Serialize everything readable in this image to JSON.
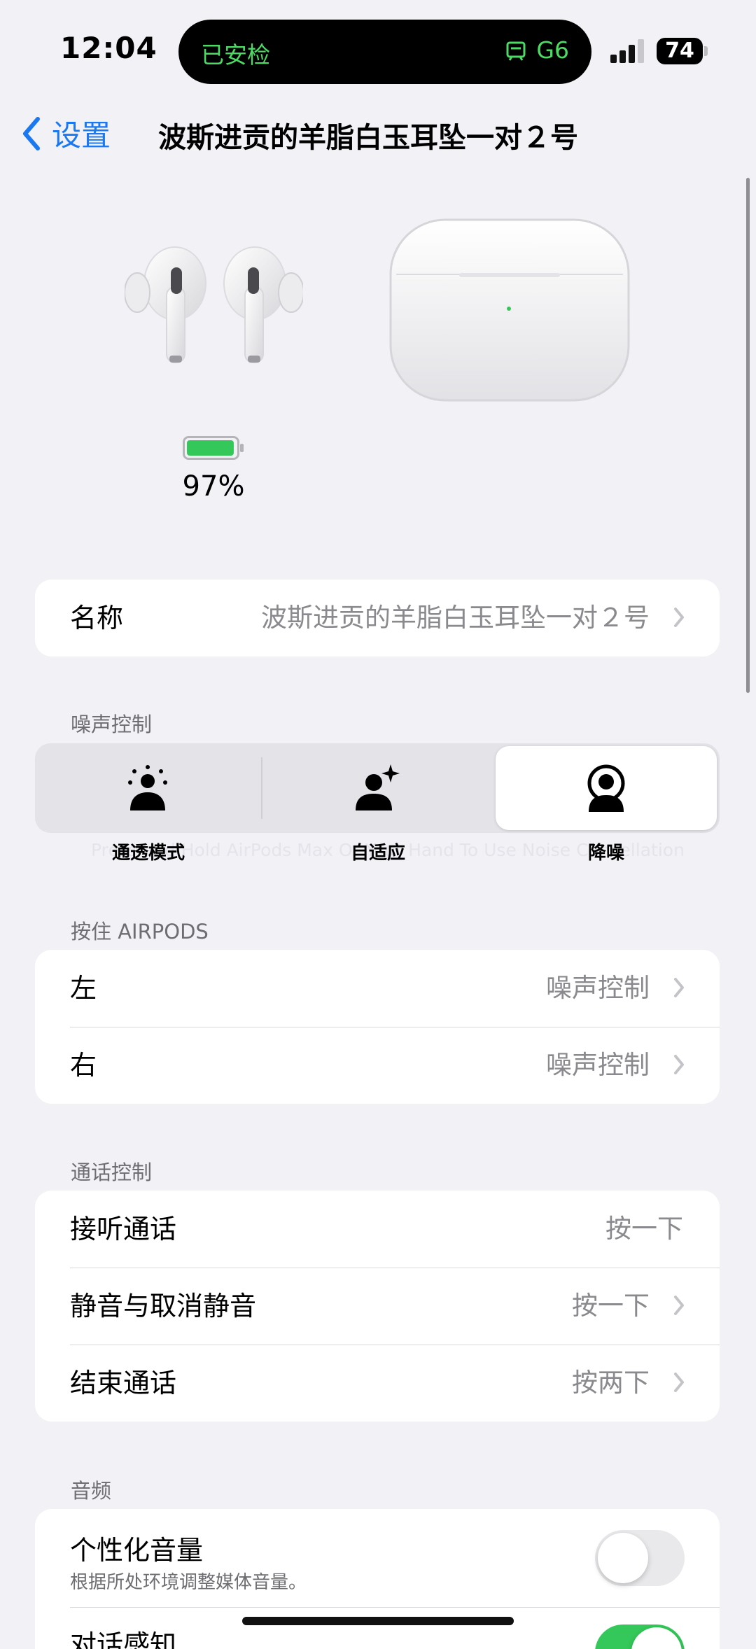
{
  "status_bar": {
    "time": "12:04",
    "island_left": "已安检",
    "island_right": "G6",
    "battery": "74"
  },
  "nav": {
    "back_label": "设置",
    "title": "波斯进贡的羊脂白玉耳坠一对２号"
  },
  "device": {
    "battery_percent": "97%",
    "battery_level": 0.97
  },
  "name_row": {
    "label": "名称",
    "value": "波斯进贡的羊脂白玉耳坠一对２号"
  },
  "noise_control": {
    "header": "噪声控制",
    "options": [
      "通透模式",
      "自适应",
      "降噪"
    ],
    "selected": "降噪",
    "hidden_hint": "Press and Hold AirPods Max Or Your Hand To Use Noise Cancellation"
  },
  "press_hold": {
    "header": "按住 AIRPODS",
    "rows": [
      {
        "label": "左",
        "value": "噪声控制"
      },
      {
        "label": "右",
        "value": "噪声控制"
      }
    ]
  },
  "call_control": {
    "header": "通话控制",
    "rows": [
      {
        "label": "接听通话",
        "value": "按一下"
      },
      {
        "label": "静音与取消静音",
        "value": "按一下"
      },
      {
        "label": "结束通话",
        "value": "按两下"
      }
    ]
  },
  "audio": {
    "header": "音频",
    "personalized_volume": {
      "label": "个性化音量",
      "sublabel": "根据所处环境调整媒体音量。",
      "enabled": false
    },
    "conversation_awareness": {
      "label": "对话感知",
      "enabled": true
    }
  },
  "colors": {
    "accent": "#1a79f1",
    "green": "#34c759",
    "background": "#f2f1f6"
  }
}
